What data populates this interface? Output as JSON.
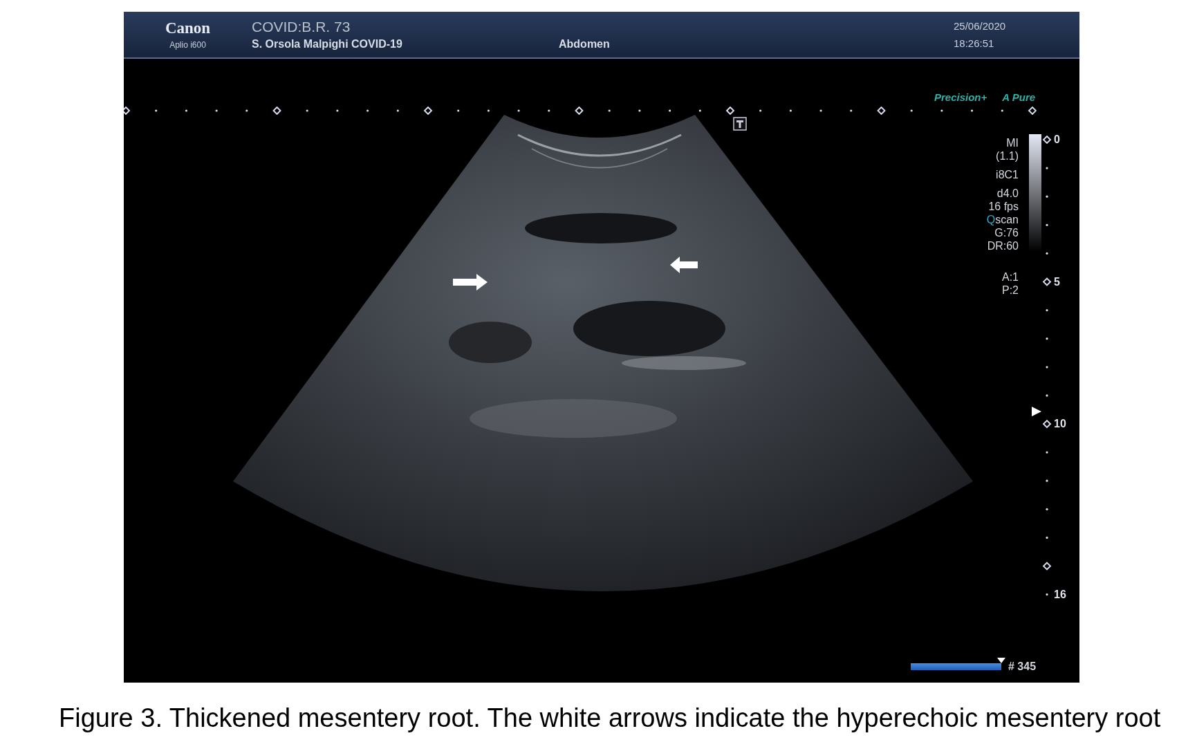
{
  "header": {
    "logo": "Canon",
    "model": "Aplio i600",
    "patient_id": "COVID:B.R. 73",
    "institution": "S. Orsola Malpighi COVID-19",
    "exam": "Abdomen",
    "date": "25/06/2020",
    "time": "18:26:51"
  },
  "image": {
    "modes": [
      "Precision+",
      "A Pure"
    ],
    "parameter_groups": [
      [
        {
          "text": "MI"
        },
        {
          "text": "(1.1)"
        }
      ],
      [
        {
          "text": "i8C1"
        }
      ],
      [
        {
          "text": "d4.0"
        },
        {
          "text": "16 fps"
        },
        {
          "accent": "Q",
          "text": "scan"
        },
        {
          "text": "G:76"
        },
        {
          "text": "DR:60"
        }
      ],
      [
        {
          "text": "A:1"
        },
        {
          "text": "P:2"
        }
      ]
    ],
    "depth_labels": [
      "0",
      "5",
      "10",
      "16"
    ],
    "cine": {
      "frame": "# 345"
    }
  },
  "caption": "Figure 3. Thickened mesentery root. The white arrows indicate the hyperechoic mesentery root"
}
